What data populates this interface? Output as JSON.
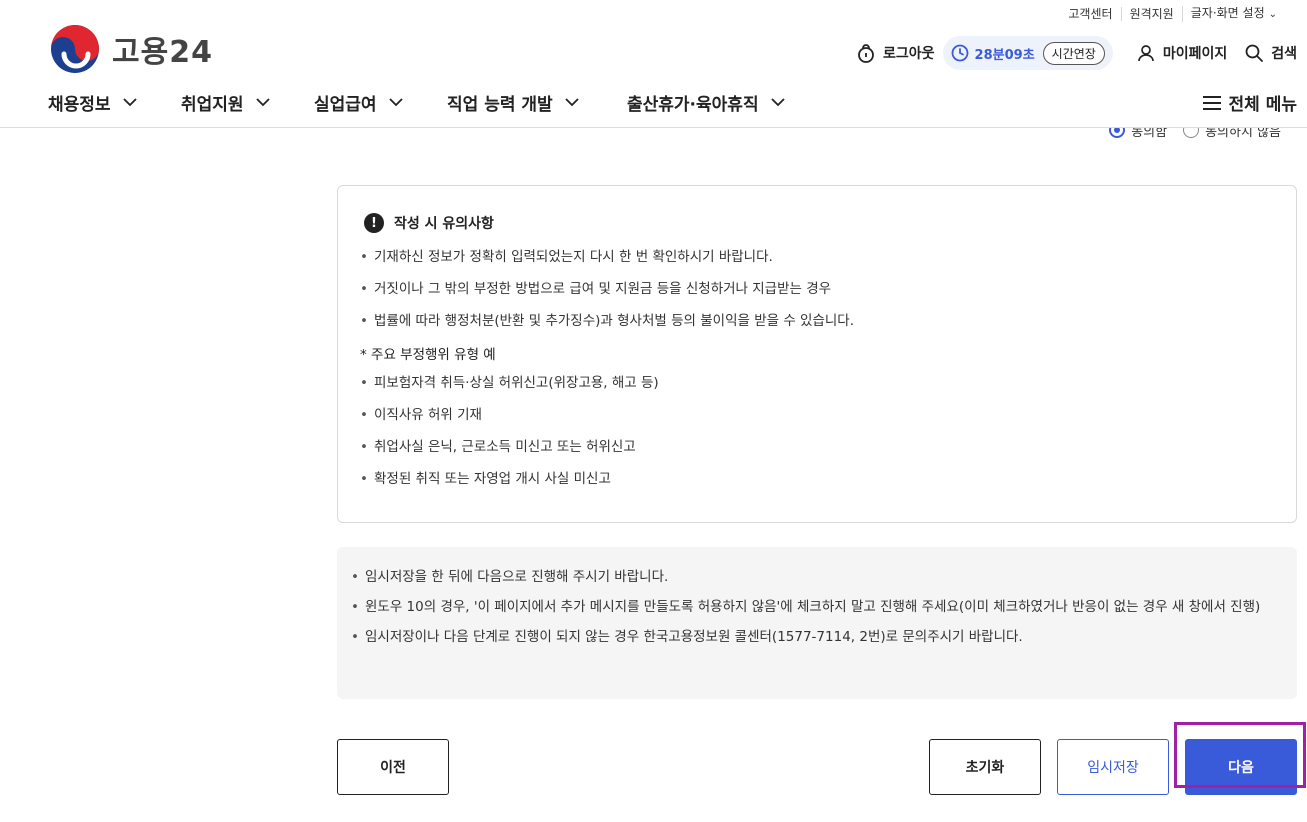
{
  "utility": {
    "customer_center": "고객센터",
    "remote_support": "원격지원",
    "display_settings": "글자·화면 설정"
  },
  "logo": {
    "text": "고용24"
  },
  "header": {
    "logout": "로그아웃",
    "session_time": "28분09초",
    "extend": "시간연장",
    "mypage": "마이페이지",
    "search": "검색"
  },
  "gnb": {
    "items": [
      "채용정보",
      "취업지원",
      "실업급여",
      "직업 능력 개발",
      "출산휴가·육아휴직"
    ],
    "all_menu": "전체 메뉴"
  },
  "agreement": {
    "agree": "동의함",
    "disagree": "동의하지 않음",
    "selected": "agree"
  },
  "notice": {
    "title": "작성 시 유의사항",
    "items": [
      "기재하신 정보가 정확히 입력되었는지 다시 한 번 확인하시기 바랍니다.",
      "거짓이나 그 밖의 부정한 방법으로 급여 및 지원금 등을 신청하거나 지급받는 경우",
      "법률에 따라 행정처분(반환 및 추가징수)과 형사처벌 등의 불이익을 받을 수 있습니다."
    ],
    "sub_heading": "* 주요 부정행위 유형 예",
    "examples": [
      "피보험자격 취득·상실 허위신고(위장고용, 해고 등)",
      "이직사유 허위 기재",
      "취업사실 은닉, 근로소득 미신고 또는 허위신고",
      "확정된 취직 또는 자영업 개시 사실 미신고"
    ]
  },
  "info": {
    "items": [
      "임시저장을 한 뒤에 다음으로 진행해 주시기 바랍니다.",
      "윈도우 10의 경우, '이 페이지에서 추가 메시지를 만들도록 허용하지 않음'에 체크하지 말고 진행해 주세요(이미 체크하였거나 반응이 없는 경우 새 창에서 진행)",
      "임시저장이나 다음 단계로 진행이 되지 않는 경우 한국고용정보원 콜센터(1577-7114, 2번)로 문의주시기 바랍니다."
    ]
  },
  "buttons": {
    "prev": "이전",
    "reset": "초기화",
    "save": "임시저장",
    "next": "다음"
  },
  "colors": {
    "accent": "#3a5bd9",
    "highlight": "#a020a8",
    "logo_red": "#e0262f",
    "logo_blue": "#1c3f8f"
  },
  "icons": {
    "logout": "lock-icon",
    "session": "clock-icon",
    "mypage": "user-icon",
    "search": "search-icon",
    "all_menu": "hamburger-icon",
    "notice": "exclamation-icon"
  }
}
